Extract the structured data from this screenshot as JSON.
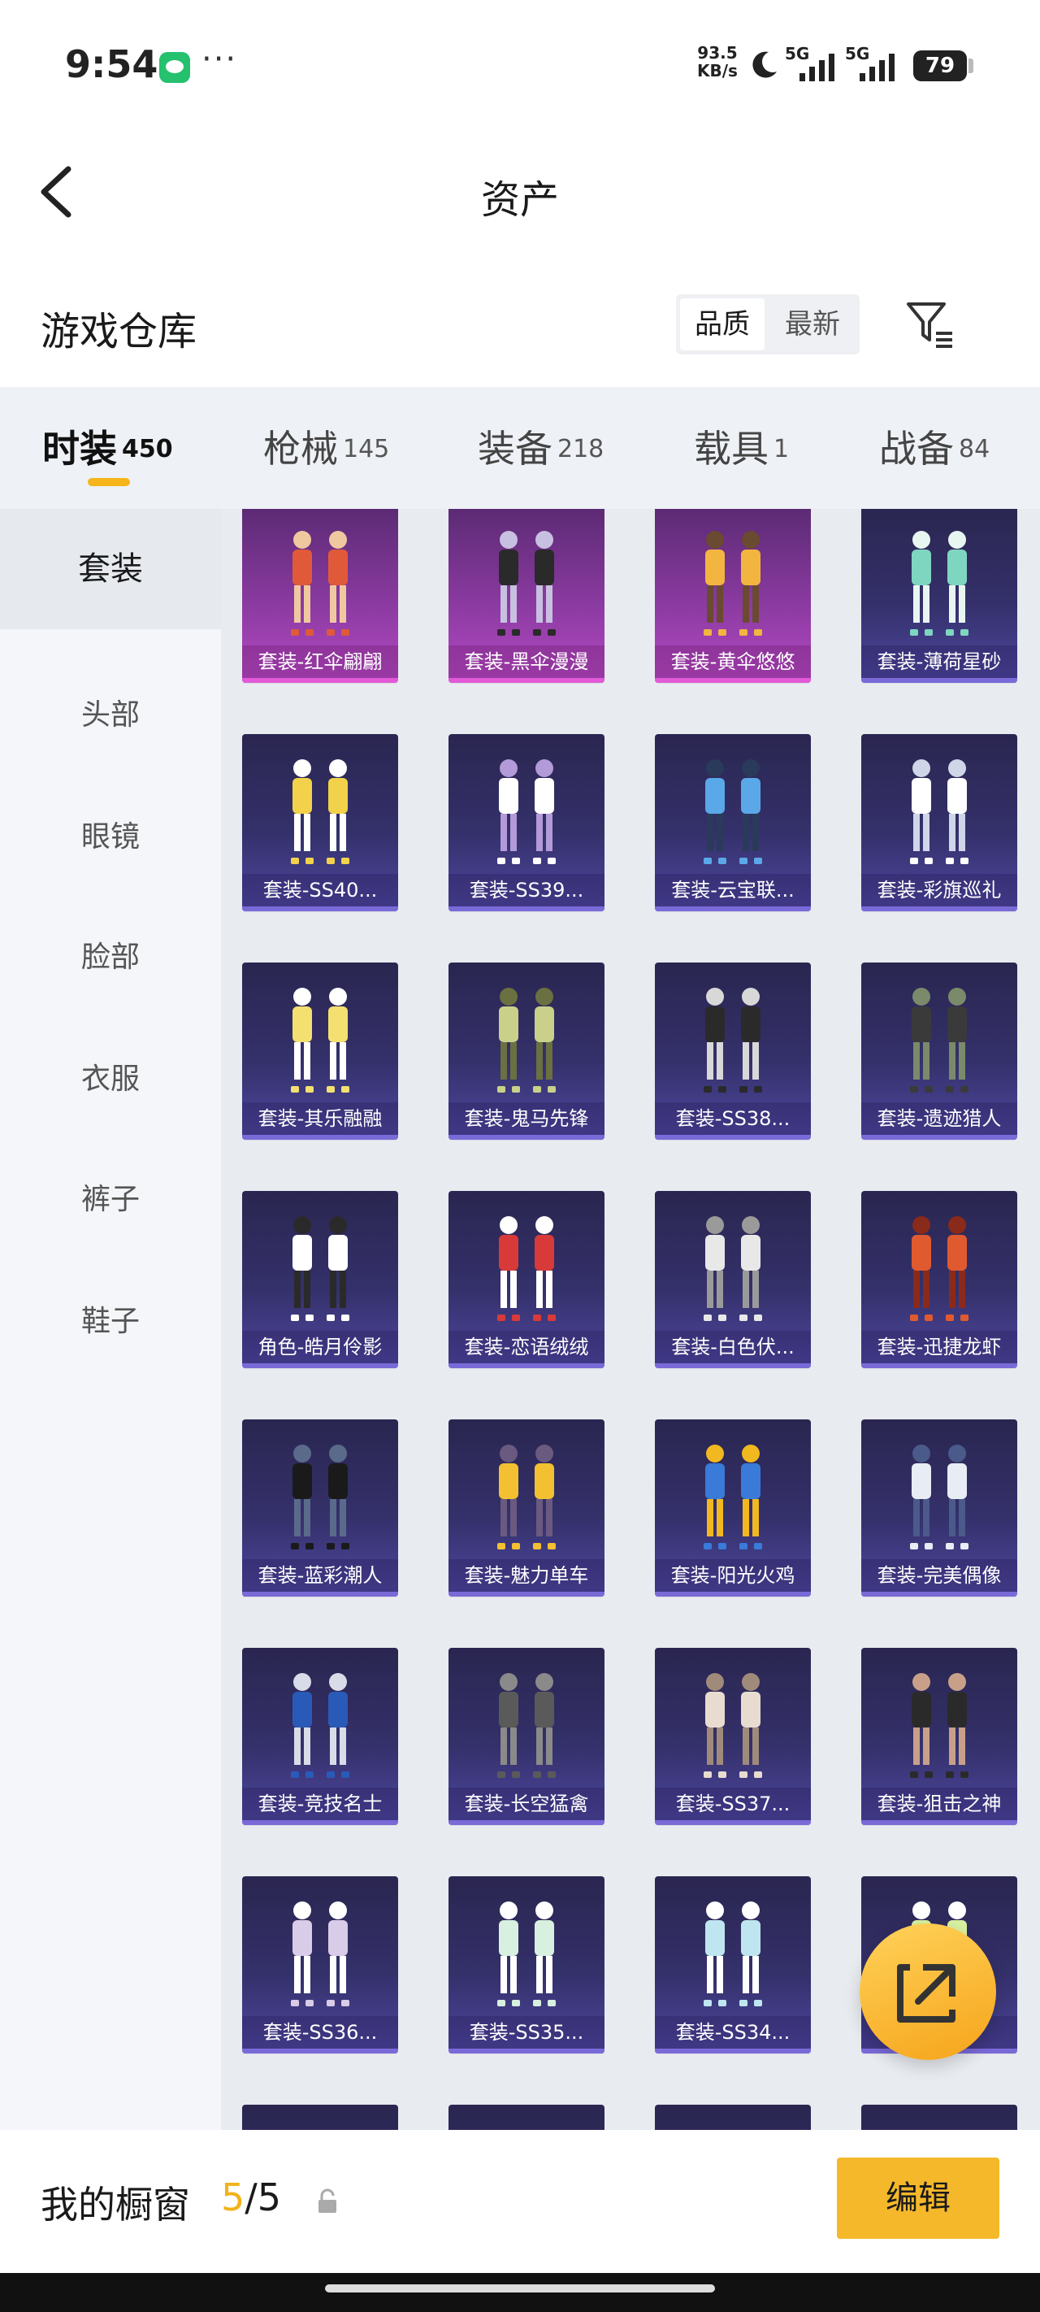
{
  "status_bar": {
    "time": "9:54",
    "speed_value": "93.5",
    "speed_unit": "KB/s",
    "net1": "5G",
    "net2": "5G",
    "battery": "79"
  },
  "header": {
    "title": "资产"
  },
  "warehouse": {
    "title": "游戏仓库",
    "sort_options": [
      "品质",
      "最新"
    ]
  },
  "tabs": [
    {
      "label": "时装",
      "count": "450"
    },
    {
      "label": "枪械",
      "count": "145"
    },
    {
      "label": "装备",
      "count": "218"
    },
    {
      "label": "载具",
      "count": "1"
    },
    {
      "label": "战备",
      "count": "84"
    }
  ],
  "sidebar": {
    "items": [
      "套装",
      "头部",
      "眼镜",
      "脸部",
      "衣服",
      "裤子",
      "鞋子"
    ]
  },
  "grid": {
    "items": [
      {
        "label": "套装-红伞翩翩",
        "rarity": "purple-pink",
        "palette": [
          "#e05a3a",
          "#f0c8a0"
        ]
      },
      {
        "label": "套装-黑伞漫漫",
        "rarity": "purple-pink",
        "palette": [
          "#2a2a2a",
          "#c8c0e0"
        ]
      },
      {
        "label": "套装-黄伞悠悠",
        "rarity": "purple-pink",
        "palette": [
          "#f2b540",
          "#6a4a30"
        ]
      },
      {
        "label": "套装-薄荷星砂",
        "rarity": "blue",
        "palette": [
          "#7fd6c0",
          "#e8f6f2"
        ]
      },
      {
        "label": "套装-SS40...",
        "rarity": "blue",
        "palette": [
          "#f2d24a",
          "#ffffff"
        ]
      },
      {
        "label": "套装-SS39...",
        "rarity": "blue",
        "palette": [
          "#ffffff",
          "#b39ad8"
        ]
      },
      {
        "label": "套装-云宝联...",
        "rarity": "blue",
        "palette": [
          "#5aa8e8",
          "#2a3a5a"
        ]
      },
      {
        "label": "套装-彩旗巡礼",
        "rarity": "blue",
        "palette": [
          "#ffffff",
          "#cfd6e8"
        ]
      },
      {
        "label": "套装-其乐融融",
        "rarity": "blue",
        "palette": [
          "#f4e070",
          "#ffffff"
        ]
      },
      {
        "label": "套装-鬼马先锋",
        "rarity": "blue",
        "palette": [
          "#c8d08a",
          "#6a7040"
        ]
      },
      {
        "label": "套装-SS38...",
        "rarity": "blue",
        "palette": [
          "#2a2a2a",
          "#d8d8d8"
        ]
      },
      {
        "label": "套装-遗迹猎人",
        "rarity": "blue",
        "palette": [
          "#3a3a3a",
          "#7a8a6a"
        ]
      },
      {
        "label": "角色-皓月伶影",
        "rarity": "blue",
        "palette": [
          "#ffffff",
          "#2a2a2a"
        ]
      },
      {
        "label": "套装-恋语绒绒",
        "rarity": "blue",
        "palette": [
          "#d83a3a",
          "#ffffff"
        ]
      },
      {
        "label": "套装-白色伏...",
        "rarity": "blue",
        "palette": [
          "#e8e8e8",
          "#9a9a9a"
        ]
      },
      {
        "label": "套装-迅捷龙虾",
        "rarity": "blue",
        "palette": [
          "#e05a30",
          "#8a2a1a"
        ]
      },
      {
        "label": "套装-蓝彩潮人",
        "rarity": "blue",
        "palette": [
          "#1a1a1a",
          "#5a6a8a"
        ]
      },
      {
        "label": "套装-魅力单车",
        "rarity": "blue",
        "palette": [
          "#f2c030",
          "#6a5a80"
        ]
      },
      {
        "label": "套装-阳光火鸡",
        "rarity": "blue",
        "palette": [
          "#3a7ad8",
          "#f2b820"
        ]
      },
      {
        "label": "套装-完美偶像",
        "rarity": "blue",
        "palette": [
          "#e8ecf4",
          "#4a5a8a"
        ]
      },
      {
        "label": "套装-竞技名士",
        "rarity": "blue",
        "palette": [
          "#2a5ab8",
          "#d8dce8"
        ]
      },
      {
        "label": "套装-长空猛禽",
        "rarity": "blue",
        "palette": [
          "#5a5a5a",
          "#8a8a8a"
        ]
      },
      {
        "label": "套装-SS37...",
        "rarity": "blue",
        "palette": [
          "#e8dcd0",
          "#a08a7a"
        ]
      },
      {
        "label": "套装-狙击之神",
        "rarity": "blue",
        "palette": [
          "#2a2a2a",
          "#c8a08a"
        ]
      },
      {
        "label": "套装-SS36...",
        "rarity": "blue",
        "palette": [
          "#d8cce8",
          "#ffffff"
        ]
      },
      {
        "label": "套装-SS35...",
        "rarity": "blue",
        "palette": [
          "#d8f0e0",
          "#ffffff"
        ]
      },
      {
        "label": "套装-SS34...",
        "rarity": "blue",
        "palette": [
          "#bfe6f0",
          "#ffffff"
        ]
      },
      {
        "label": "",
        "rarity": "blue",
        "palette": [
          "#d8f0a0",
          "#ffffff"
        ]
      },
      {
        "label": "",
        "rarity": "blue",
        "palette": [
          "#e0e0e0",
          "#ffffff"
        ]
      },
      {
        "label": "",
        "rarity": "blue",
        "palette": [
          "#d85a5a",
          "#2a2a2a"
        ]
      },
      {
        "label": "",
        "rarity": "blue",
        "palette": [
          "#2a2a2a",
          "#ffffff"
        ]
      },
      {
        "label": "",
        "rarity": "blue",
        "palette": [
          "#3a3a3a",
          "#ffffff"
        ]
      }
    ]
  },
  "bottom_bar": {
    "showcase_label": "我的橱窗",
    "showcase_current": "5",
    "showcase_sep": "/",
    "showcase_max": "5",
    "edit_label": "编辑"
  },
  "colors": {
    "accent": "#f5b82a",
    "tab_underline": "#f5b51b"
  },
  "icons": {
    "back": "chevron-left-icon",
    "filter": "filter-icon",
    "share": "share-icon",
    "lock": "lock-icon"
  }
}
